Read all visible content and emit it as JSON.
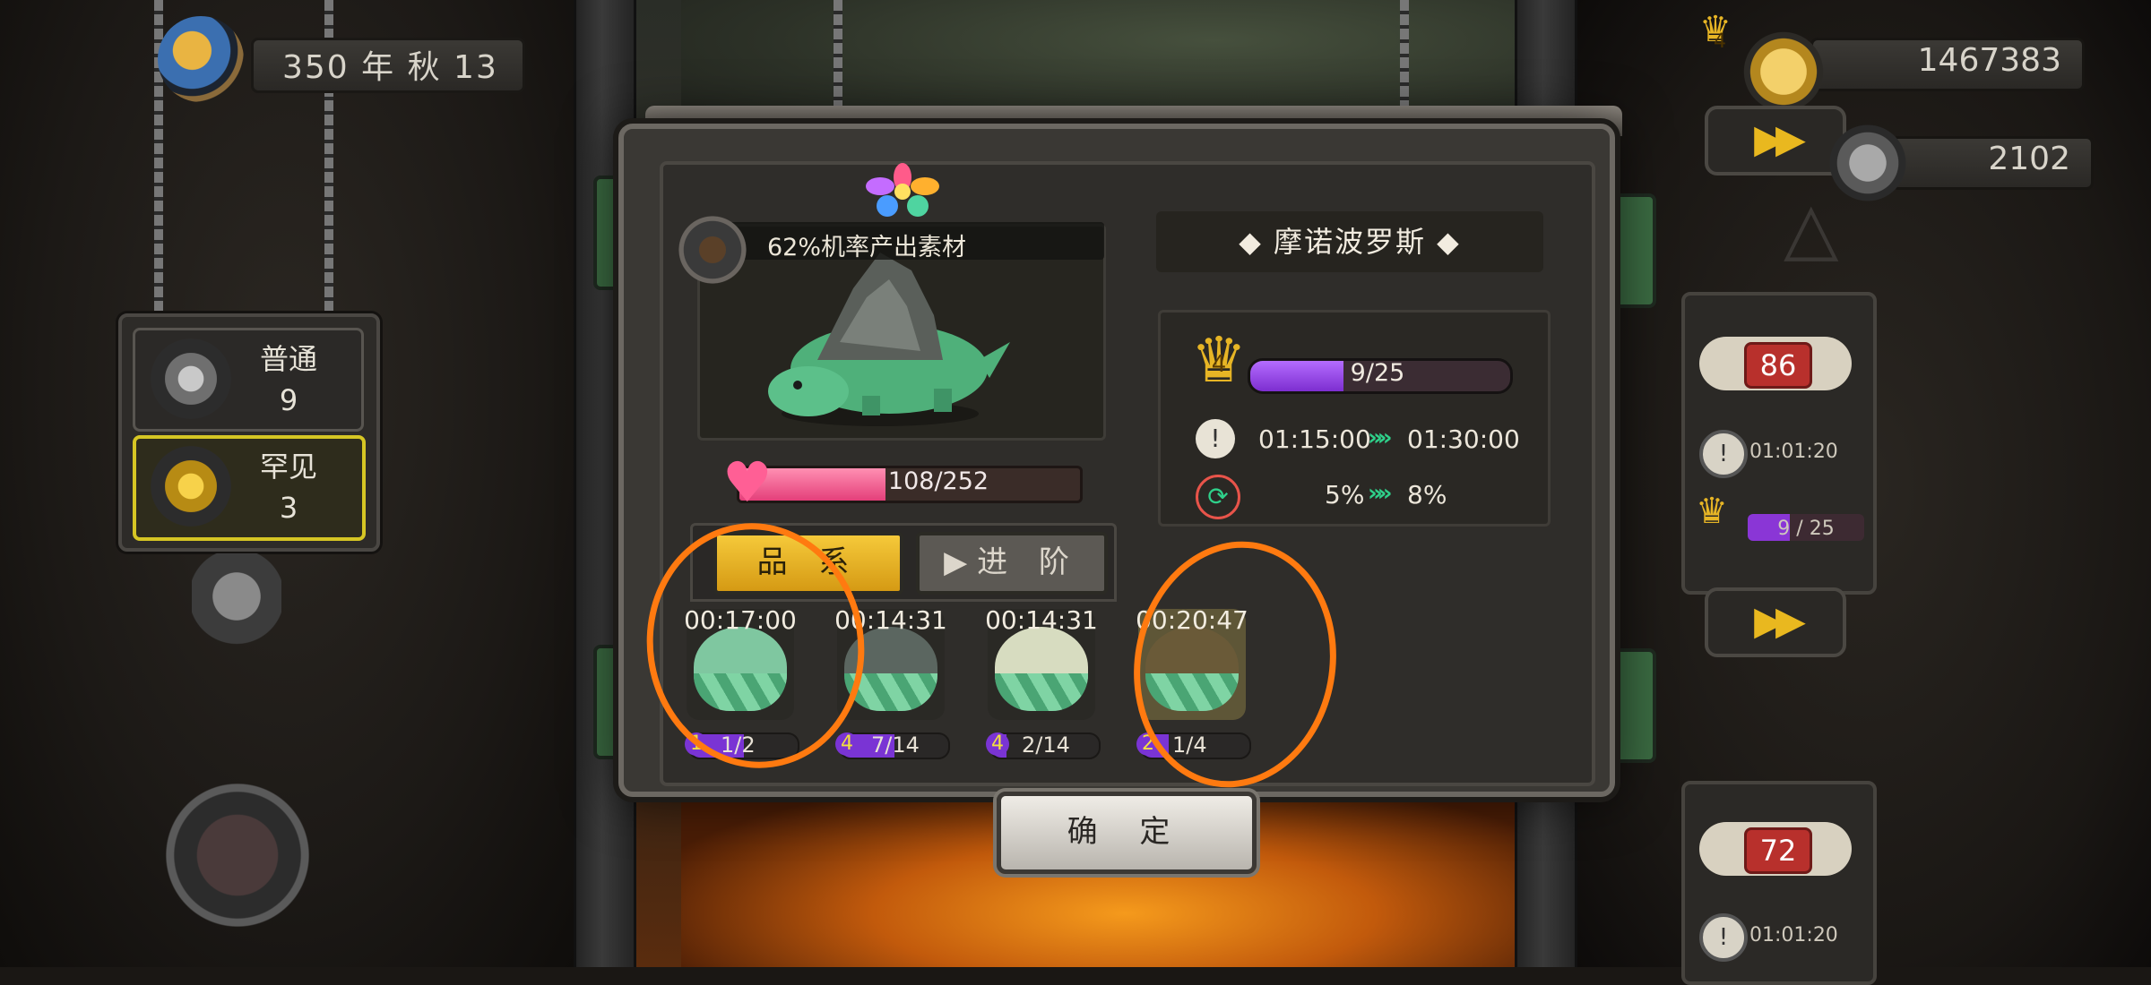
{
  "hud": {
    "date": "350 年 秋 13",
    "gold": "1467383",
    "meat": "2102",
    "gold_crown_level": "4"
  },
  "rarity_filter": {
    "items": [
      {
        "label": "普通",
        "count": "9"
      },
      {
        "label": "罕见",
        "count": "3"
      }
    ]
  },
  "right_cards": [
    {
      "bone_value": "86",
      "timer": "01:01:20",
      "crown_level": "4",
      "progress_text": "9 / 25",
      "progress": 0.36
    },
    {
      "bone_value": "72",
      "timer": "01:01:20"
    }
  ],
  "dialog": {
    "drop_chance_text": "62%机率产出素材",
    "monster_name": "摩诺波罗斯",
    "hp_text": "108/252",
    "hp_progress": 0.43,
    "tabs": {
      "breed": "品 系",
      "advance": "进 阶"
    },
    "level": {
      "crown_level": "4",
      "progress_text": "9/25",
      "progress": 0.36
    },
    "time": {
      "from": "01:15:00",
      "to": "01:30:00"
    },
    "rate": {
      "from": "5%",
      "to": "8%"
    },
    "eggs": [
      {
        "timer": "00:17:00",
        "level": "1",
        "count": "1/2",
        "progress": 0.5,
        "color": "#7fc7a0"
      },
      {
        "timer": "00:14:31",
        "level": "4",
        "count": "7/14",
        "progress": 0.5,
        "color": "#5b6660"
      },
      {
        "timer": "00:14:31",
        "level": "4",
        "count": "2/14",
        "progress": 0.14,
        "color": "#d7dcc0"
      },
      {
        "timer": "00:20:47",
        "level": "2",
        "count": "1/4",
        "progress": 0.25,
        "color": "#6a5a38"
      }
    ],
    "confirm_label": "确 定"
  },
  "colors": {
    "accent_gold": "#e7b525",
    "annotation_orange": "#ff7a10",
    "progress_purple": "#7d2ed0",
    "hp_pink": "#e43f7a"
  },
  "icons": {
    "date": "moon-sun-icon",
    "gold": "coin-icon",
    "meat": "meat-can-icon",
    "speed": "fast-forward-icon",
    "level": "crown-icon",
    "timer": "clock-icon",
    "rate": "cycle-icon",
    "hp": "heart-icon",
    "material": "sprout-icon"
  }
}
